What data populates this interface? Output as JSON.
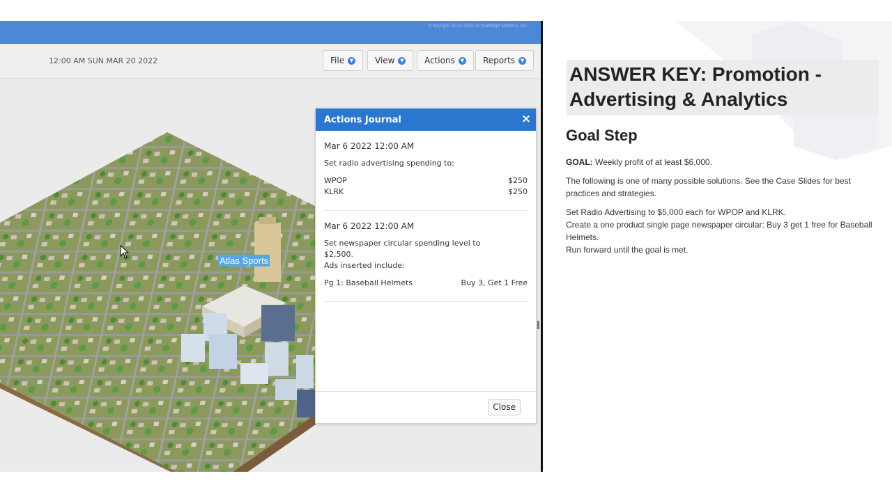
{
  "sim": {
    "copyright": "Copyright 2014-2020 Knowledge Matters, Inc.",
    "date_time": "12:00 AM SUN MAR 20 2022",
    "menus": [
      {
        "label": "File"
      },
      {
        "label": "View"
      },
      {
        "label": "Actions"
      },
      {
        "label": "Reports"
      }
    ],
    "store_label": "Atlas Sports"
  },
  "journal": {
    "title": "Actions Journal",
    "close_x": "×",
    "entries": [
      {
        "date": "Mar 6 2022 12:00 AM",
        "description": "Set radio advertising spending to:",
        "rows": [
          {
            "name": "WPOP",
            "value": "$250"
          },
          {
            "name": "KLRK",
            "value": "$250"
          }
        ]
      },
      {
        "date": "Mar 6 2022 12:00 AM",
        "description_1": "Set newspaper circular spending level to",
        "description_2": "$2,500.",
        "description_3": "Ads inserted include:",
        "rows": [
          {
            "name": "Pg 1: Baseball Helmets",
            "value": "Buy 3, Get 1 Free"
          }
        ]
      }
    ],
    "close_label": "Close"
  },
  "answer_key": {
    "title": "ANSWER KEY: Promotion - Advertising & Analytics",
    "section_heading": "Goal Step",
    "goal_label": "GOAL:",
    "goal_text": " Weekly profit of at least $6,000.",
    "intro": "The following is one of many possible solutions. See the Case Slides for best practices and strategies.",
    "steps": [
      "Set Radio Advertising to $5,000 each for WPOP and KLRK.",
      "Create a one product single page newspaper circular: Buy 3 get 1 free for Baseball Helmets.",
      "Run forward until the goal is met."
    ]
  },
  "colors": {
    "header_blue": "#4d88d6",
    "dialog_header_blue": "#2b76cf",
    "label_highlight": "#55a8e4"
  }
}
